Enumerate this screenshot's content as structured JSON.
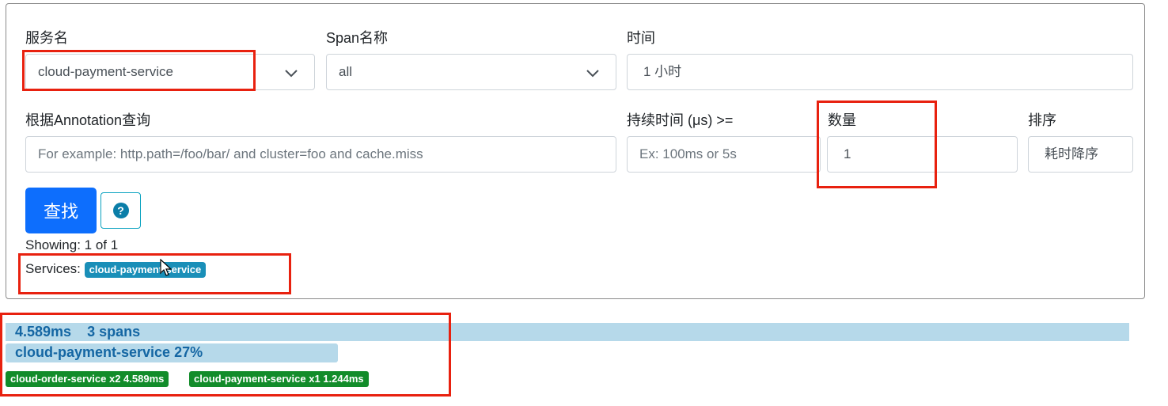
{
  "form": {
    "service_label": "服务名",
    "service_value": "cloud-payment-service",
    "span_label": "Span名称",
    "span_value": "all",
    "time_label": "时间",
    "time_value": "1 小时",
    "annotation_label": "根据Annotation查询",
    "annotation_placeholder": "For example: http.path=/foo/bar/ and cluster=foo and cache.miss",
    "duration_label": "持续时间 (μs) >=",
    "duration_placeholder": "Ex: 100ms or 5s",
    "limit_label": "数量",
    "limit_value": "1",
    "sort_label": "排序",
    "sort_value": "耗时降序",
    "find_button": "查找",
    "help_icon": "question-circle-icon"
  },
  "results": {
    "showing": "Showing: 1 of 1",
    "services_label": "Services:",
    "service_badge": "cloud-payment-service"
  },
  "trace": {
    "summary_duration": "4.589ms",
    "summary_spans": "3 spans",
    "service_percent_text": "cloud-payment-service 27%",
    "service_percent": 27,
    "tags": [
      "cloud-order-service x2 4.589ms",
      "cloud-payment-service x1 1.244ms"
    ]
  },
  "colors": {
    "primary": "#0d6efd",
    "highlight_red": "#e8210f",
    "trace_bar": "#b6d9ea",
    "trace_text": "#1466a3",
    "service_badge": "#1a8fb8",
    "green_badge": "#128c2a"
  }
}
